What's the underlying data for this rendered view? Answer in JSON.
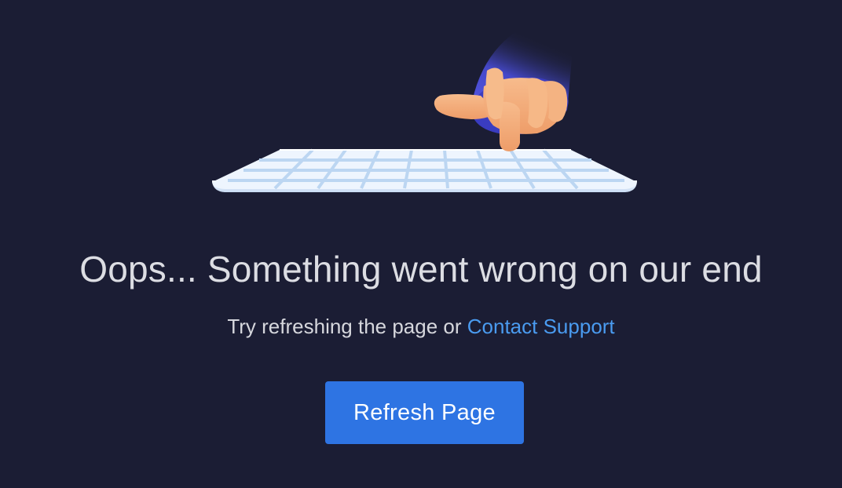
{
  "error": {
    "title": "Oops... Something went wrong on our end",
    "message_prefix": "Try refreshing the page or ",
    "support_link_label": "Contact Support",
    "refresh_button_label": "Refresh Page"
  },
  "illustration": {
    "description_icon": "hand-tapping-keyboard-icon",
    "colors": {
      "background": "#1b1d34",
      "keyboard": "#e9f2fd",
      "keyboard_grid": "#bcd6f2",
      "sleeve": "#5a5cf0",
      "hand": "#f3ad7c"
    }
  },
  "theme": {
    "text_color": "#dcdde3",
    "link_color": "#4a9bf0",
    "button_color": "#2e74e3"
  }
}
